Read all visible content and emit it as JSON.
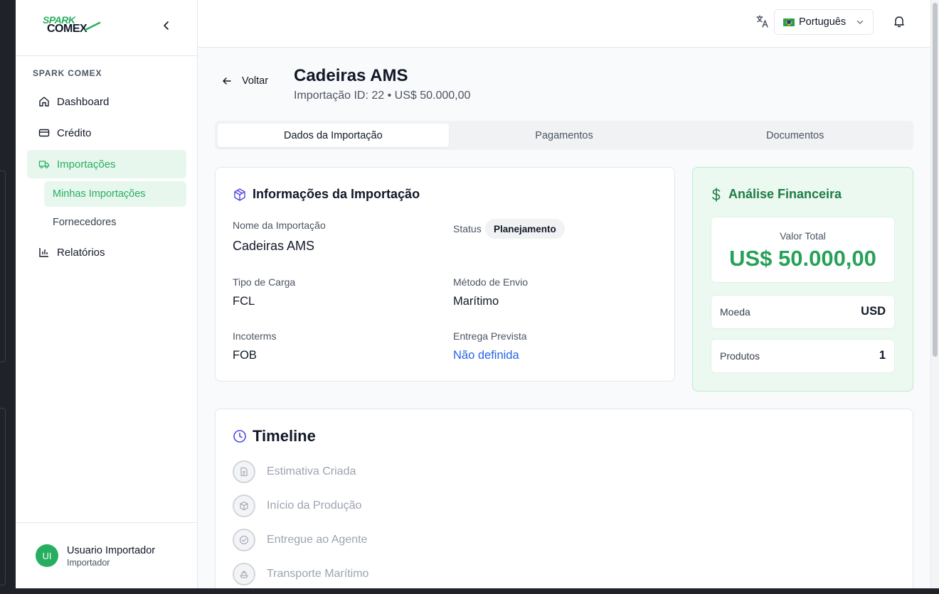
{
  "brand": {
    "logo_line1": "SPARK",
    "logo_line2": "COMEX",
    "accent": "#27ae60",
    "link": "#2563eb"
  },
  "sidebar": {
    "section_title": "SPARK COMEX",
    "items": [
      {
        "label": "Dashboard",
        "icon": "home-icon"
      },
      {
        "label": "Crédito",
        "icon": "credit-card-icon"
      },
      {
        "label": "Importações",
        "icon": "truck-icon",
        "active": true
      },
      {
        "label": "Relatórios",
        "icon": "bar-chart-icon"
      }
    ],
    "subitems": [
      {
        "label": "Minhas Importações",
        "active": true
      },
      {
        "label": "Fornecedores"
      }
    ],
    "user": {
      "initials": "UI",
      "name": "Usuario Importador",
      "role": "Importador"
    }
  },
  "topbar": {
    "language": "Português",
    "language_flag": "brazil-flag-icon"
  },
  "header": {
    "back_label": "Voltar",
    "title": "Cadeiras AMS",
    "subtitle": "Importação ID: 22 • US$ 50.000,00"
  },
  "tabs": [
    {
      "label": "Dados da Importação",
      "active": true
    },
    {
      "label": "Pagamentos"
    },
    {
      "label": "Documentos"
    }
  ],
  "info": {
    "title": "Informações da Importação",
    "name_label": "Nome da Importação",
    "name_value": "Cadeiras AMS",
    "status_label": "Status",
    "status_value": "Planejamento",
    "cargo_label": "Tipo de Carga",
    "cargo_value": "FCL",
    "shipping_label": "Método de Envio",
    "shipping_value": "Marítimo",
    "incoterms_label": "Incoterms",
    "incoterms_value": "FOB",
    "delivery_label": "Entrega Prevista",
    "delivery_value": "Não definida"
  },
  "finance": {
    "title": "Análise Financeira",
    "total_label": "Valor Total",
    "total_value": "US$ 50.000,00",
    "currency_label": "Moeda",
    "currency_value": "USD",
    "products_label": "Produtos",
    "products_value": "1"
  },
  "timeline": {
    "title": "Timeline",
    "steps": [
      {
        "label": "Estimativa Criada",
        "icon": "document-icon"
      },
      {
        "label": "Início da Produção",
        "icon": "package-icon"
      },
      {
        "label": "Entregue ao Agente",
        "icon": "check-circle-icon"
      },
      {
        "label": "Transporte Marítimo",
        "icon": "ship-icon"
      }
    ]
  }
}
